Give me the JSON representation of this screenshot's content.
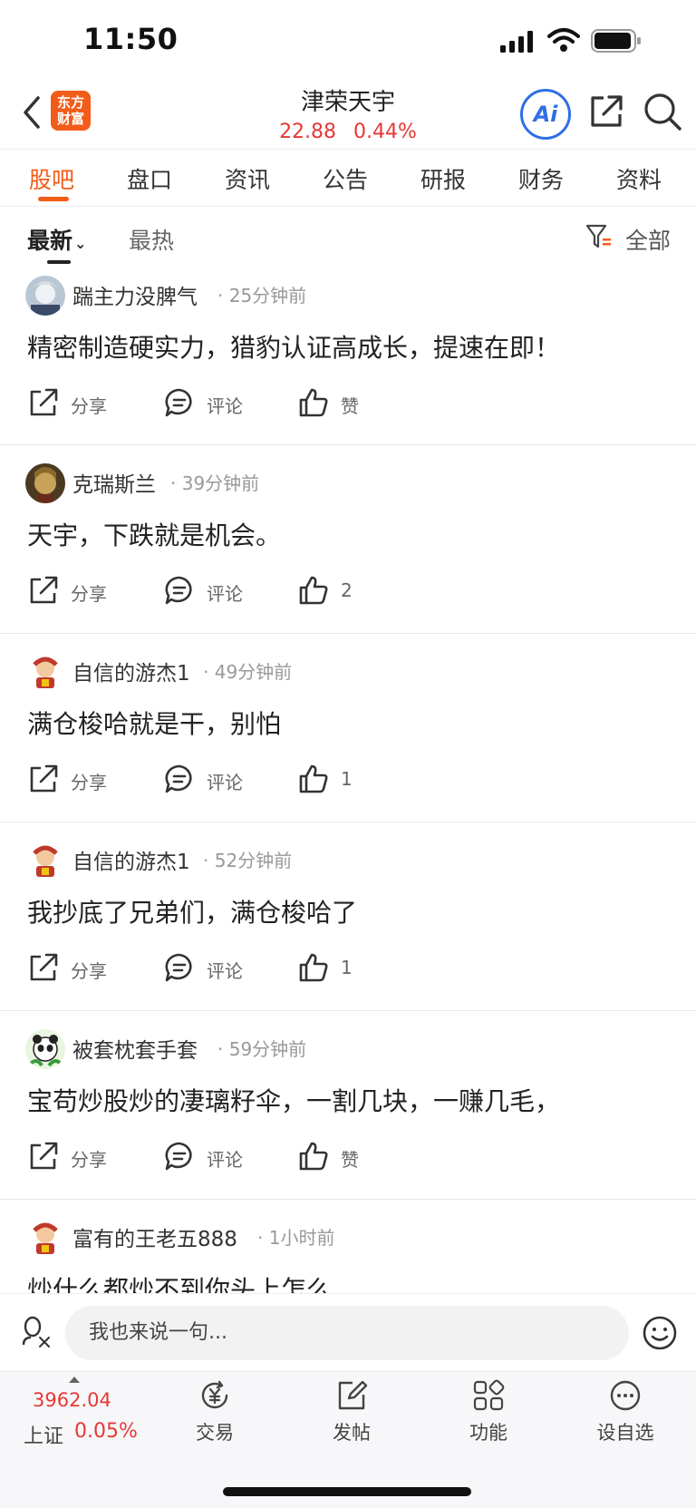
{
  "status_bar": {
    "time": "11:50"
  },
  "header": {
    "logo_text_line1": "东方",
    "logo_text_line2": "财富",
    "stock_name": "津荣天宇",
    "price": "22.88",
    "change_pct": "0.44%",
    "ai_label": "Ai",
    "icons": [
      "back-icon",
      "share-icon",
      "search-icon"
    ]
  },
  "tabs": [
    {
      "label": "股吧",
      "active": true
    },
    {
      "label": "盘口"
    },
    {
      "label": "资讯"
    },
    {
      "label": "公告"
    },
    {
      "label": "研报"
    },
    {
      "label": "财务"
    },
    {
      "label": "资料"
    }
  ],
  "filter": {
    "latest": "最新",
    "hot": "最热",
    "all": "全部"
  },
  "actions": {
    "share": "分享",
    "comment": "评论",
    "like": "赞"
  },
  "posts": [
    {
      "user": "踹主力没脾气",
      "time": "25分钟前",
      "content": "精密制造硬实力，猎豹认证高成长，提速在即！",
      "likes": "赞"
    },
    {
      "user": "克瑞斯兰",
      "time": "39分钟前",
      "content": "天宇，下跌就是机会。",
      "likes": "2"
    },
    {
      "user": "自信的游杰1",
      "time": "49分钟前",
      "content": "满仓梭哈就是干，别怕",
      "likes": "1"
    },
    {
      "user": "自信的游杰1",
      "time": "52分钟前",
      "content": "我抄底了兄弟们，满仓梭哈了",
      "likes": "1"
    },
    {
      "user": "被套枕套手套",
      "time": "59分钟前",
      "content": "宝苟炒股炒的凄璃籽伞，一割几块，一赚几毛，",
      "likes": "赞"
    },
    {
      "user": "富有的王老五888",
      "time": "1小时前",
      "content": "炒什么都炒不到你头上怎么"
    }
  ],
  "input": {
    "placeholder": "我也来说一句..."
  },
  "bottom_nav": {
    "index_value": "3962.04",
    "index_name": "上证",
    "index_pct": "0.05%",
    "items": [
      {
        "label": "交易",
        "icon": "trade-icon"
      },
      {
        "label": "发帖",
        "icon": "post-icon"
      },
      {
        "label": "功能",
        "icon": "apps-icon"
      },
      {
        "label": "设自选",
        "icon": "more-icon"
      }
    ]
  },
  "colors": {
    "brand": "#f25c19",
    "up": "#e53935",
    "ai": "#2f6fe4"
  }
}
